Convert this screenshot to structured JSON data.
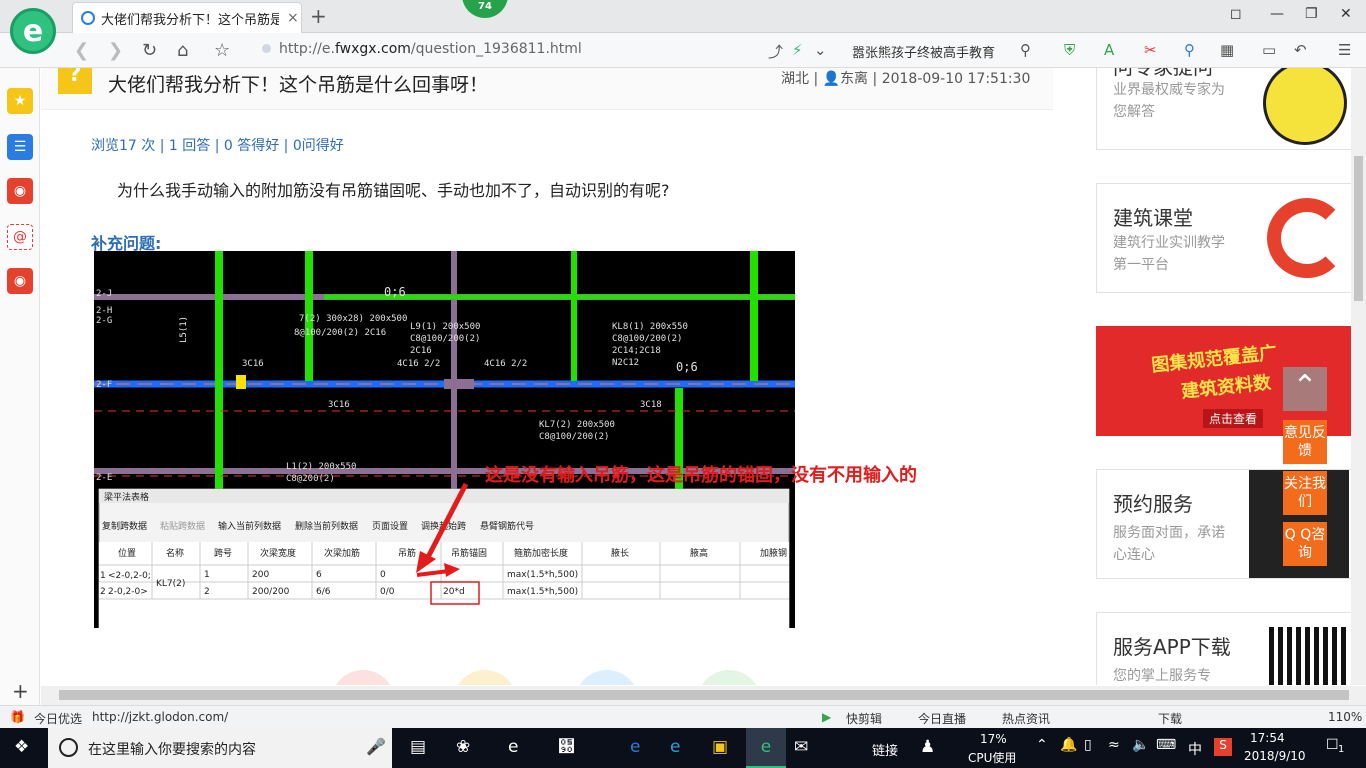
{
  "browser": {
    "tab_title": "大佬们帮我分析下！这个吊筋是什么回事呀！",
    "tab_badge": "74",
    "url_prefix": "http://e.",
    "url_domain": "fwxgx.com",
    "url_path": "/question_1936811.html",
    "search_suggestion": "嚣张熊孩子终被高手教育",
    "new_tab": "+",
    "close_tab": "×"
  },
  "question": {
    "title": "大佬们帮我分析下！这个吊筋是什么回事呀！",
    "region": "湖北",
    "author": "东离",
    "datetime": "2018-09-10 17:51:30",
    "stats": "浏览17 次 | 1 回答 | 0 答得好 | 0问得好",
    "body": "为什么我手动输入的附加筋没有吊筋锚固呢、手动也加不了，自动识别的有呢?",
    "supplement_label": "补充问题:",
    "annotation": "这是没有输入吊筋，这是吊筋的锚固，没有不用输入的"
  },
  "cad": {
    "labels": [
      "2-J",
      "2-H",
      "2-G",
      "2-F",
      "2-E",
      "3C16",
      "4C16 2/2",
      "4C16 2/2",
      "0;6",
      "0;6",
      "3C16",
      "3C18",
      "L5(1)",
      "KL7(2) 200x500",
      "C8@100/200(2)",
      "L1(2) 200x550",
      "C8@200(2)",
      "KL8(1) 200x550",
      "C8@100/200(2)",
      "2C14;2C18",
      "N2C12",
      "L9(1) 200x500",
      "C8@100/200(2)",
      "2C16",
      "8@100/200(2) 2C16",
      "7(2) 300x28) 200x500"
    ],
    "dialog": {
      "title": "梁平法表格",
      "toolbar": [
        "复制跨数据",
        "粘贴跨数据",
        "输入当前列数据",
        "删除当前列数据",
        "页面设置",
        "调换起始跨",
        "悬臂钢筋代号"
      ],
      "columns": [
        "位置",
        "名称",
        "跨号",
        "次梁宽度",
        "次梁加筋",
        "吊筋",
        "吊筋锚固",
        "箍筋加密长度",
        "腋长",
        "腋高",
        "加腋钢"
      ],
      "rows": [
        [
          "<2-0,2-0;",
          "KL7(2)",
          "1",
          "200",
          "6",
          "0",
          "",
          "max(1.5*h,500)",
          "",
          "",
          ""
        ],
        [
          "2-0,2-0>",
          "",
          "2",
          "200/200",
          "6/6",
          "0/0",
          "20*d",
          "max(1.5*h,500)",
          "",
          "",
          ""
        ]
      ],
      "row_numbers": [
        "1",
        "2"
      ]
    }
  },
  "sidebar_right": {
    "cards": [
      {
        "title": "问专家提问",
        "sub": "业界最权威专家为您解答"
      },
      {
        "title": "建筑课堂",
        "sub": "建筑行业实训教学第一平台"
      },
      {
        "title": "图集规范覆盖广",
        "sub": "建筑资料数",
        "button": "点击查看"
      },
      {
        "title": "预约服务",
        "sub": "服务面对面，承诺心连心"
      },
      {
        "title": "服务APP下载",
        "sub": "您的掌上服务专"
      }
    ],
    "float_buttons": [
      "意见反馈",
      "关注我们",
      "Q Q咨询"
    ]
  },
  "status_bar": {
    "items": [
      "今日优选",
      "http://jzkt.glodon.com/",
      "快剪辑",
      "今日直播",
      "热点资讯",
      "下载",
      "110%"
    ]
  },
  "taskbar": {
    "search_placeholder": "在这里输入你要搜索的内容",
    "link_label": "链接",
    "cpu_percent": "17%",
    "cpu_label": "CPU使用",
    "ime": "中",
    "time": "17:54",
    "date": "2018/9/10",
    "notif_count": "1"
  },
  "colors": {
    "brand_green": "#2ec27e",
    "link_blue": "#2c6db5",
    "annotation_red": "#e31b1b",
    "float_orange": "#f26c1c",
    "cad_green": "#22e000",
    "cad_blue": "#1e6bff",
    "cad_purple": "#8c6f95"
  }
}
